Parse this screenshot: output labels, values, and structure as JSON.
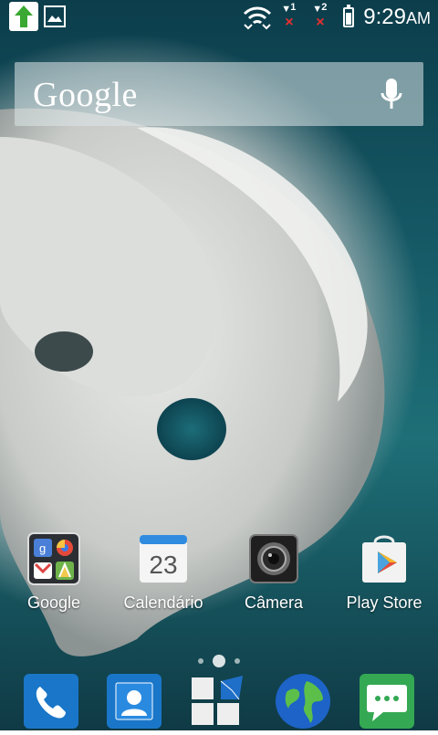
{
  "status_bar": {
    "time": "9:29",
    "am_pm": "AM",
    "sim1_label": "1",
    "sim2_label": "2",
    "sim_status": "×",
    "battery_level": 0.7,
    "notifications": [
      "upload-arrow-icon",
      "image-icon"
    ]
  },
  "search": {
    "logo_text": "Google",
    "voice_icon": "microphone-icon"
  },
  "apps": [
    {
      "label": "Google",
      "icon": "google-folder-icon"
    },
    {
      "label": "Calendário",
      "icon": "calendar-icon",
      "day": "23"
    },
    {
      "label": "Câmera",
      "icon": "camera-icon"
    },
    {
      "label": "Play Store",
      "icon": "play-store-icon"
    }
  ],
  "page_indicator": {
    "count": 3,
    "active": 1
  },
  "dock": [
    {
      "icon": "phone-icon"
    },
    {
      "icon": "contacts-icon"
    },
    {
      "icon": "app-drawer-icon"
    },
    {
      "icon": "browser-globe-icon"
    },
    {
      "icon": "messaging-icon"
    }
  ],
  "colors": {
    "accent_green": "#3aa832",
    "sim_error": "#e53030",
    "dock_blue": "#1a76c8",
    "dock_green": "#34a853"
  }
}
